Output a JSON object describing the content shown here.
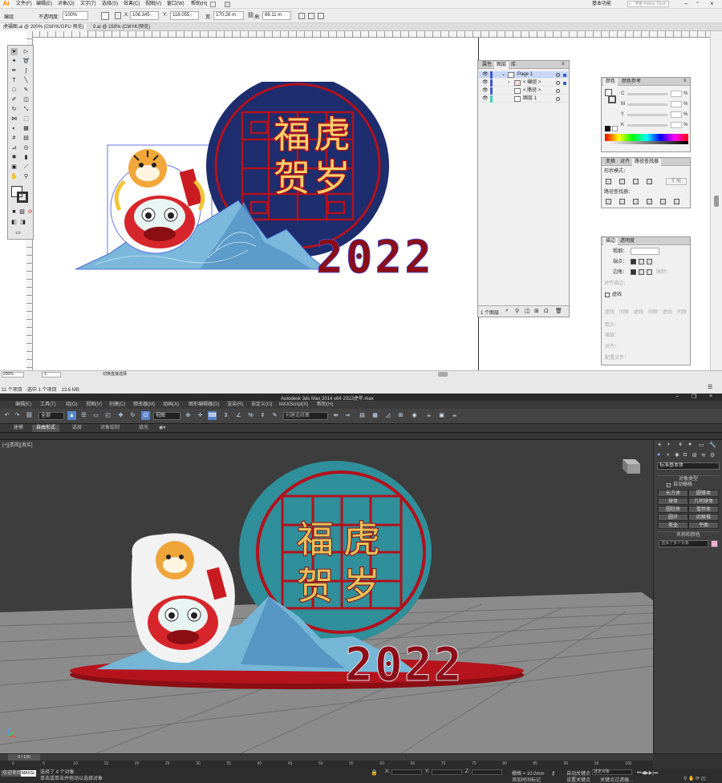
{
  "ai": {
    "logo": "Ai",
    "menus": [
      "文件(F)",
      "编辑(E)",
      "对象(O)",
      "文字(T)",
      "选择(S)",
      "效果(C)",
      "视图(V)",
      "窗口(W)",
      "帮助(H)"
    ],
    "workspace": "基本功能",
    "search_placeholder": "搜索 Adobe Stock",
    "control": {
      "object_type": "编组",
      "opacity_label": "不透明度:",
      "opacity_value": "100%",
      "x_label": "X:",
      "x_value": "108.345 ₍",
      "y_label": "Y:",
      "y_value": "118.055 ₍",
      "w_label": "宽:",
      "w_value": "170.28 m",
      "h_label": "高:",
      "h_value": "86.11 m"
    },
    "tabs": [
      "虎福图.ai @ 200% (CMYK/GPU 预览)",
      "0.ai @ 150% (CMYK/预览)"
    ],
    "status": {
      "zoom": "200%",
      "page": "1",
      "tool": "切换直接选择"
    },
    "layers_panel": {
      "tabs": [
        "属性",
        "图层",
        "库"
      ],
      "rows": [
        {
          "name": "Page 1"
        },
        {
          "name": "< 编组 >"
        },
        {
          "name": "< 路径 >"
        },
        {
          "name": "图层 1"
        }
      ],
      "footer": "1 个图层"
    },
    "color_panel": {
      "tabs": [
        "颜色",
        "颜色参考"
      ],
      "channels": [
        "C",
        "M",
        "Y",
        "K"
      ],
      "unit": "%"
    },
    "pathfinder_panel": {
      "tabs": [
        "变换",
        "对齐",
        "路径查找器"
      ],
      "shape_modes": "形状模式：",
      "expand": "扩展",
      "pathfinders": "路径查找器："
    },
    "stroke_panel": {
      "tabs": [
        "描边",
        "透明度"
      ],
      "weight": "粗细：",
      "cap": "端点：",
      "corner": "边角：",
      "limit": "限制：",
      "align": "对齐描边：",
      "dashed": "虚线",
      "dash_labels": [
        "虚线",
        "间隙",
        "虚线",
        "间隙",
        "虚线",
        "间隙"
      ],
      "arrow": "箭头：",
      "scale": "缩放：",
      "align2": "对齐：",
      "profile": "配置文件："
    },
    "artwork": {
      "chars": [
        "福",
        "虎",
        "贺",
        "岁"
      ],
      "year": "2022"
    }
  },
  "win": {
    "left_info": "11 个项目　选中 1 个项目　13.6 MB"
  },
  "max": {
    "title": "Autodesk 3ds Max  2014 x64     2022虎年.max",
    "menus": [
      "编辑(E)",
      "工具(T)",
      "组(G)",
      "视图(V)",
      "创建(C)",
      "修改器(M)",
      "动画(A)",
      "图形编辑器(D)",
      "渲染(R)",
      "自定义(U)",
      "MAXScript(X)",
      "帮助(H)"
    ],
    "selection_filter": "全部",
    "coord_system": "视图",
    "named_selection": "创建选择集",
    "ribbon_tabs": [
      "建模",
      "自由形式",
      "选择",
      "对象绘制",
      "填充"
    ],
    "viewport_label": "[+][透视][真实]",
    "command_panel": {
      "dropdown": "标准基本体",
      "object_type_header": "对象类型",
      "autogrid": "自动栅格",
      "buttons": [
        "长方体",
        "圆锥体",
        "球体",
        "几何球体",
        "圆柱体",
        "管状体",
        "圆环",
        "四棱锥",
        "茶壶",
        "平面"
      ],
      "name_color_header": "名称和颜色",
      "name_value": "选择了多个对象"
    },
    "timeline": {
      "frame": "0 / 100",
      "ticks": [
        "0",
        "5",
        "10",
        "15",
        "20",
        "25",
        "30",
        "35",
        "40",
        "45",
        "50",
        "55",
        "60",
        "65",
        "70",
        "75",
        "80",
        "85",
        "90",
        "95",
        "100"
      ]
    },
    "status": {
      "welcome": "欢迎使用",
      "maxscript": "MAXSc",
      "selected": "选择了 4 个对象",
      "prompt": "单击或单击并拖动以选择对象",
      "x_label": "X:",
      "y_label": "Y:",
      "z_label": "Z:",
      "grid": "栅格 = 10.0mm",
      "add_time_tag": "添加时间标记",
      "autokey": "自动关键点",
      "selected_obj": "选定对象",
      "set_key": "设置关键点",
      "key_filters": "关键点过滤器..."
    }
  }
}
